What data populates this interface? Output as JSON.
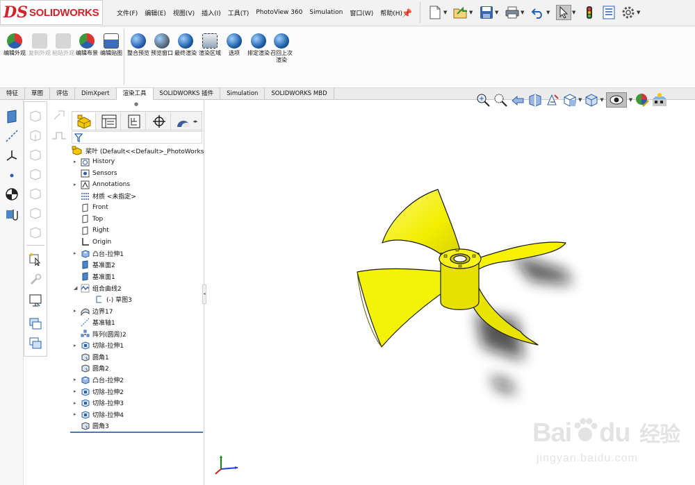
{
  "app": {
    "logo_ds": "DS",
    "logo_name": "SOLIDWORKS"
  },
  "menu": [
    "文件(F)",
    "编辑(E)",
    "视图(V)",
    "插入(I)",
    "工具(T)",
    "PhotoView 360",
    "Simulation",
    "窗口(W)",
    "帮助(H)"
  ],
  "ribbon": {
    "buttons": [
      {
        "label": "编辑外观",
        "icon": "edit-appearance-icon",
        "enabled": true
      },
      {
        "label": "复制外观",
        "icon": "copy-appearance-icon",
        "enabled": false
      },
      {
        "label": "粘贴外观",
        "icon": "paste-appearance-icon",
        "enabled": false
      },
      {
        "label": "编辑布景",
        "icon": "edit-scene-icon",
        "enabled": true
      },
      {
        "label": "编辑贴图",
        "icon": "edit-decal-icon",
        "enabled": true
      },
      {
        "label": "整合预览",
        "icon": "integrated-preview-icon",
        "enabled": true
      },
      {
        "label": "预览窗口",
        "icon": "preview-window-icon",
        "enabled": true
      },
      {
        "label": "最终渲染",
        "icon": "final-render-icon",
        "enabled": true
      },
      {
        "label": "渲染区域",
        "icon": "render-region-icon",
        "enabled": true
      },
      {
        "label": "选项",
        "icon": "options-icon",
        "enabled": true
      },
      {
        "label": "排定渲染",
        "icon": "schedule-render-icon",
        "enabled": true
      },
      {
        "label": "召回上次渲染",
        "icon": "recall-last-render-icon",
        "enabled": true
      }
    ]
  },
  "tabs": [
    {
      "label": "特征",
      "active": false
    },
    {
      "label": "草图",
      "active": false
    },
    {
      "label": "评估",
      "active": false
    },
    {
      "label": "DimXpert",
      "active": false
    },
    {
      "label": "渲染工具",
      "active": true
    },
    {
      "label": "SOLIDWORKS 插件",
      "active": false
    },
    {
      "label": "Simulation",
      "active": false
    },
    {
      "label": "SOLIDWORKS MBD",
      "active": false
    }
  ],
  "tree": {
    "root": "桨叶  (Default<<Default>_PhotoWorks",
    "items": [
      {
        "label": "History",
        "icon": "history-folder-icon",
        "expandable": true,
        "indent": 0
      },
      {
        "label": "Sensors",
        "icon": "sensors-icon",
        "expandable": false,
        "indent": 0
      },
      {
        "label": "Annotations",
        "icon": "annotations-icon",
        "expandable": true,
        "indent": 0
      },
      {
        "label": "材质 <未指定>",
        "icon": "material-icon",
        "expandable": false,
        "indent": 0
      },
      {
        "label": "Front",
        "icon": "plane-icon",
        "expandable": false,
        "indent": 0
      },
      {
        "label": "Top",
        "icon": "plane-icon",
        "expandable": false,
        "indent": 0
      },
      {
        "label": "Right",
        "icon": "plane-icon",
        "expandable": false,
        "indent": 0
      },
      {
        "label": "Origin",
        "icon": "origin-icon",
        "expandable": false,
        "indent": 0
      },
      {
        "label": "凸台-拉伸1",
        "icon": "boss-extrude-icon",
        "expandable": true,
        "indent": 0
      },
      {
        "label": "基准面2",
        "icon": "ref-plane-icon",
        "expandable": false,
        "indent": 0
      },
      {
        "label": "基准面1",
        "icon": "ref-plane-icon",
        "expandable": false,
        "indent": 0
      },
      {
        "label": "组合曲线2",
        "icon": "composite-curve-icon",
        "expandable": true,
        "expanded": true,
        "indent": 0
      },
      {
        "label": "(-) 草图3",
        "icon": "sketch-icon",
        "expandable": false,
        "indent": 1
      },
      {
        "label": "边界17",
        "icon": "boundary-icon",
        "expandable": true,
        "indent": 0
      },
      {
        "label": "基准轴1",
        "icon": "ref-axis-icon",
        "expandable": false,
        "indent": 0
      },
      {
        "label": "阵列(圆周)2",
        "icon": "circular-pattern-icon",
        "expandable": false,
        "indent": 0
      },
      {
        "label": "切除-拉伸1",
        "icon": "cut-extrude-icon",
        "expandable": true,
        "indent": 0
      },
      {
        "label": "圆角1",
        "icon": "fillet-icon",
        "expandable": false,
        "indent": 0
      },
      {
        "label": "圆角2",
        "icon": "fillet-icon",
        "expandable": false,
        "indent": 0
      },
      {
        "label": "凸台-拉伸2",
        "icon": "boss-extrude-icon",
        "expandable": true,
        "indent": 0
      },
      {
        "label": "切除-拉伸2",
        "icon": "cut-extrude-icon",
        "expandable": true,
        "indent": 0
      },
      {
        "label": "切除-拉伸3",
        "icon": "cut-extrude-icon",
        "expandable": true,
        "indent": 0
      },
      {
        "label": "切除-拉伸4",
        "icon": "cut-extrude-icon",
        "expandable": true,
        "indent": 0
      },
      {
        "label": "圆角3",
        "icon": "fillet-icon",
        "expandable": false,
        "indent": 0
      }
    ]
  },
  "watermark": {
    "brand": "Bai",
    "brand2": "du",
    "cn": "经验",
    "url": "jingyan.baidu.com"
  },
  "colors": {
    "accent": "#d2232a",
    "model": "#f5f20a",
    "selection": "#2b6fd6"
  }
}
